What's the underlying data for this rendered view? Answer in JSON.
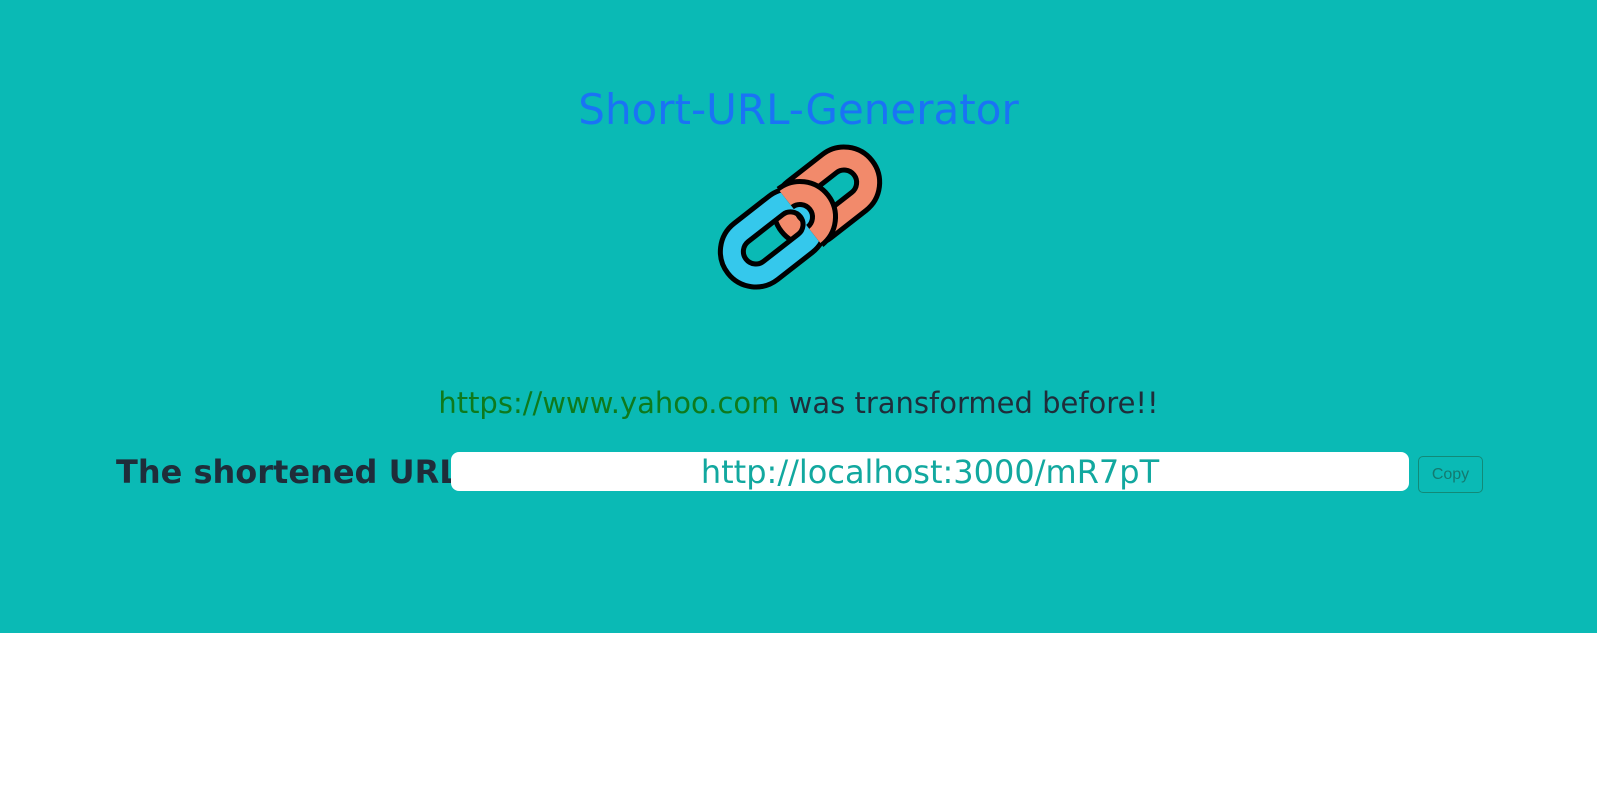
{
  "app": {
    "title": "Short-URL-Generator"
  },
  "logo": {
    "icon": "chain-link-icon"
  },
  "message": {
    "original_url": "https://www.yahoo.com",
    "suffix": " was transformed before!!"
  },
  "result": {
    "label": "The shortened URL =",
    "short_url": "http://localhost:3000/mR7pT",
    "copy_label": "Copy"
  },
  "colors": {
    "background": "#0abab5",
    "title": "#1a73f5",
    "original_url": "#0e7a1d",
    "short_url_text": "#12a89f",
    "link_orange": "#f28a6b",
    "link_blue": "#35c8ec"
  }
}
